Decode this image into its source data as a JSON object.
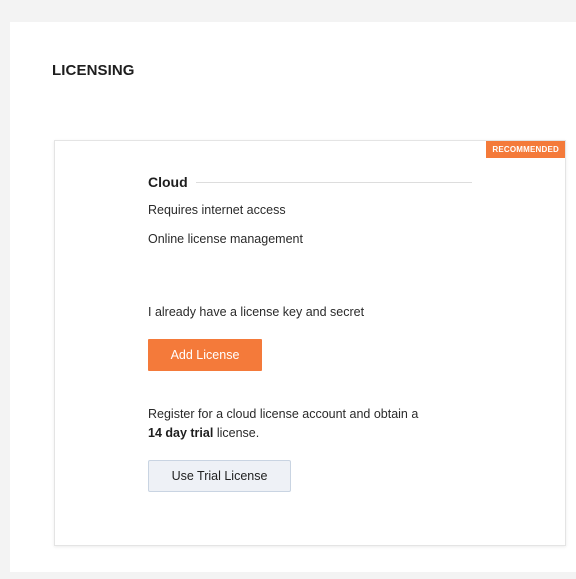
{
  "panel": {
    "title": "LICENSING"
  },
  "card": {
    "badge": "RECOMMENDED",
    "heading": "Cloud",
    "features": [
      "Requires internet access",
      "Online license management"
    ],
    "have_key_text": "I already have a license key and secret",
    "add_license_label": "Add License",
    "register_text_before": "Register for a cloud license account and obtain a",
    "register_bold": "14 day trial",
    "register_text_after": "license.",
    "trial_button_label": "Use Trial License"
  },
  "colors": {
    "accent": "#f47a3a",
    "secondary_button_bg": "#eef1f6",
    "secondary_button_border": "#c9d4e2",
    "page_bg": "#f3f3f3"
  }
}
